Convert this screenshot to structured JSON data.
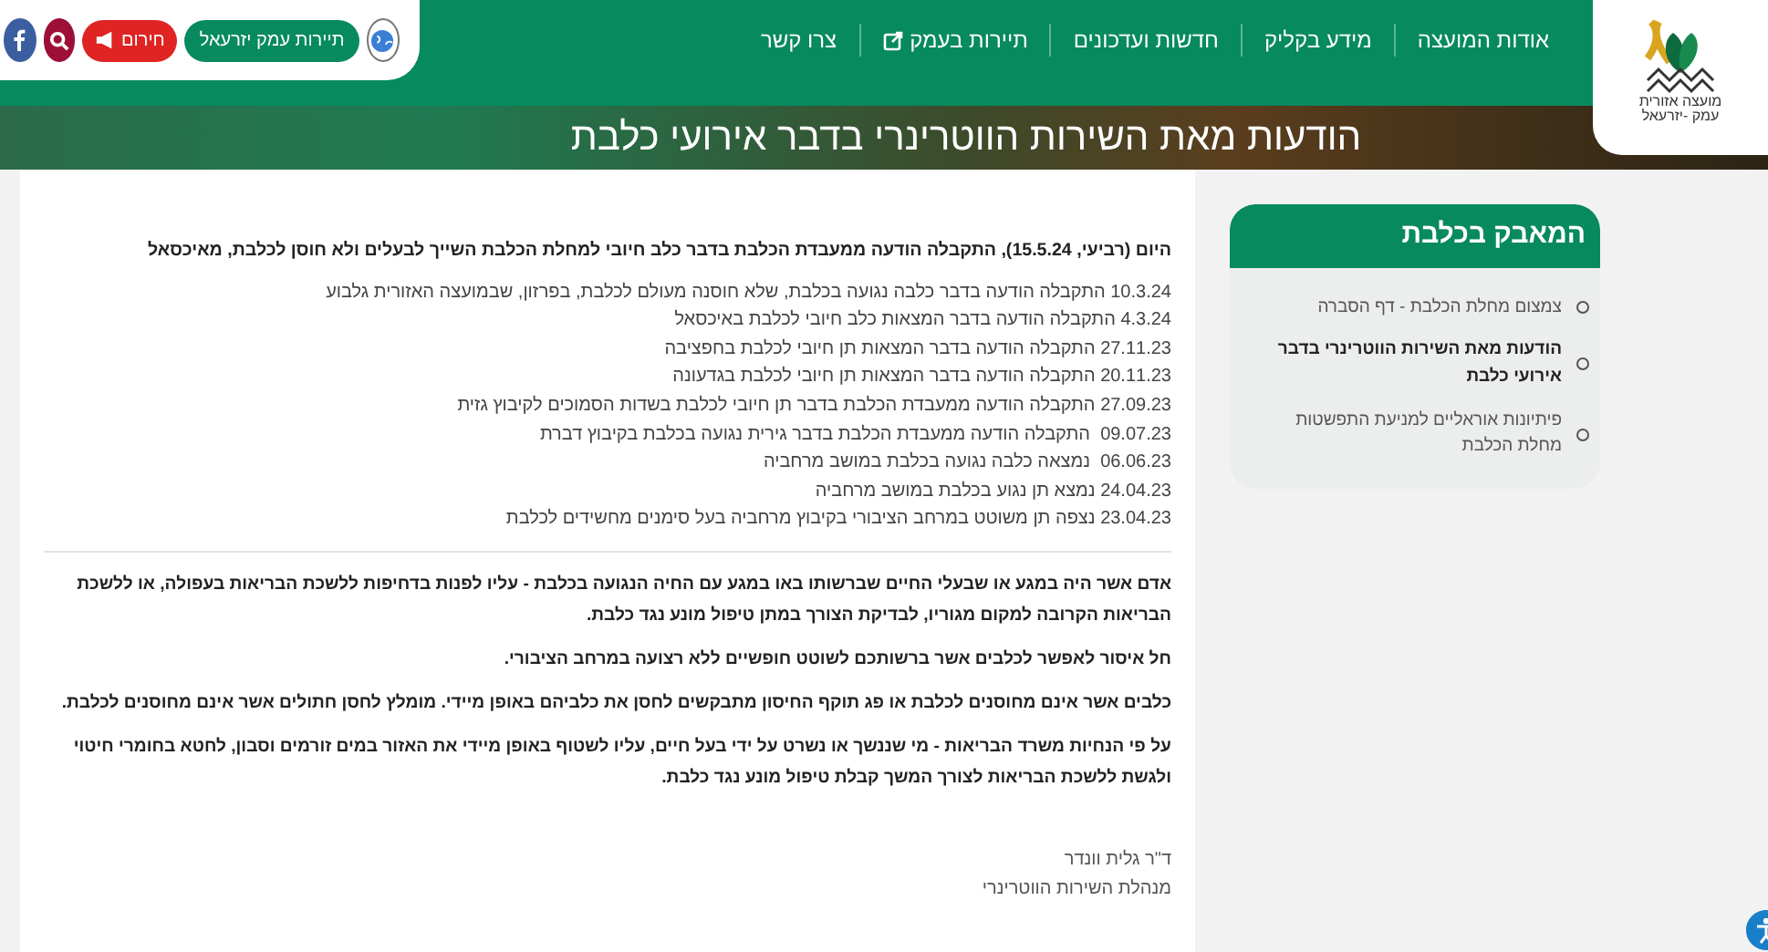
{
  "top_bar": {
    "buttons": [
      {
        "kind": "globe"
      },
      {
        "kind": "pill",
        "label": "תיירות עמק יזרעאל"
      },
      {
        "kind": "alert",
        "label": "חירום"
      },
      {
        "kind": "search"
      },
      {
        "kind": "facebook"
      }
    ]
  },
  "nav": {
    "items": [
      {
        "label": "אודות המועצה",
        "external": false
      },
      {
        "label": "מידע בקליק",
        "external": false
      },
      {
        "label": "חדשות ועדכונים",
        "external": false
      },
      {
        "label": "תיירות בעמק",
        "external": true
      },
      {
        "label": "צרו קשר",
        "external": false
      }
    ]
  },
  "logo": {
    "lines": [
      "מועצה אזורית",
      "עמק -יזרעאל"
    ]
  },
  "hero": {
    "title": "הודעות מאת השירות הווטרינרי בדבר אירועי כלבת"
  },
  "article": {
    "intro": "היום (רביעי, 15.5.24), התקבלה הודעה ממעבדת הכלבת בדבר כלב חיובי למחלת הכלבת השייך לבעלים ולא חוסן לכלבת, מאיכסאל",
    "updates": [
      "10.3.24 התקבלה הודעה בדבר כלבה נגועה בכלבת, שלא חוסנה מעולם לכלבת, בפרזון, שבמועצה האזורית גלבוע",
      "4.3.24 התקבלה הודעה בדבר המצאות כלב חיובי לכלבת באיכסאל",
      "27.11.23 התקבלה הודעה בדבר המצאות תן חיובי לכלבת בחפציבה",
      "20.11.23 התקבלה הודעה בדבר המצאות תן חיובי לכלבת בגדעונה",
      "27.09.23 התקבלה הודעה ממעבדת הכלבת בדבר תן חיובי לכלבת בשדות הסמוכים לקיבוץ גזית",
      "09.07.23  התקבלה הודעה ממעבדת הכלבת בדבר גירית נגועה בכלבת בקיבוץ דברת",
      "06.06.23  נמצאה כלבה נגועה בכלבת במושב מרחביה",
      "24.04.23 נמצא תן נגוע בכלבת במושב מרחביה",
      "23.04.23 נצפה תן משוטט במרחב הציבורי בקיבוץ מרחביה בעל סימנים מחשידים לכלבת"
    ],
    "paragraphs": [
      "אדם אשר היה במגע או שבעלי החיים שברשותו באו במגע עם החיה הנגועה בכלבת - עליו לפנות בדחיפות ללשכת הבריאות בעפולה, או ללשכת הבריאות הקרובה למקום מגוריו, לבדיקת הצורך במתן טיפול מונע נגד כלבת.",
      "חל איסור לאפשר לכלבים אשר ברשותכם לשוטט חופשיים ללא רצועה במרחב הציבורי.",
      "כלבים אשר אינם מחוסנים לכלבת או פג תוקף החיסון מתבקשים לחסן את כלביהם באופן מיידי. מומלץ לחסן חתולים אשר אינם מחוסנים לכלבת.",
      "על פי הנחיות משרד הבריאות - מי שננשך או נשרט על ידי בעל חיים, עליו לשטוף באופן מיידי את האזור במים זורמים וסבון, לחטא בחומרי חיטוי ולגשת ללשכת הבריאות לצורך המשך קבלת טיפול מונע נגד כלבת."
    ],
    "signature": [
      "ד\"ר גלית וונדר",
      "מנהלת השירות הווטרינרי"
    ]
  },
  "sidebar": {
    "title": "המאבק בכלבת",
    "items": [
      {
        "label": "צמצום מחלת הכלבת - דף הסברה",
        "selected": false
      },
      {
        "label": "הודעות מאת השירות הווטרינרי בדבר אירועי כלבת",
        "selected": true
      },
      {
        "label": "פיתיונות אוראליים למניעת התפשטות מחלת הכלבת",
        "selected": false
      }
    ]
  }
}
